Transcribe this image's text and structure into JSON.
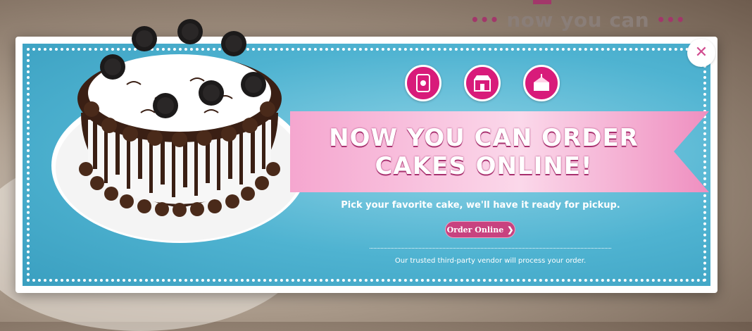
{
  "background": {
    "headline": "now you can",
    "dots_left": "•••",
    "dots_right": "•••"
  },
  "modal": {
    "close_label": "✕",
    "headline_line1": "NOW YOU CAN ORDER",
    "headline_line2": "CAKES ONLINE!",
    "subline": "Pick your favorite cake, we'll have it ready for pickup.",
    "order_button_label": "Order Online",
    "order_button_arrow": "❯",
    "vendor_note": "Our trusted third-party vendor will process your order.",
    "icons": [
      "tablet-order-icon",
      "storefront-icon",
      "cake-slice-icon"
    ]
  },
  "colors": {
    "accent_pink": "#d81b7a",
    "panel_blue": "#4fb3d1",
    "ribbon_pink": "#f3a9cf"
  }
}
